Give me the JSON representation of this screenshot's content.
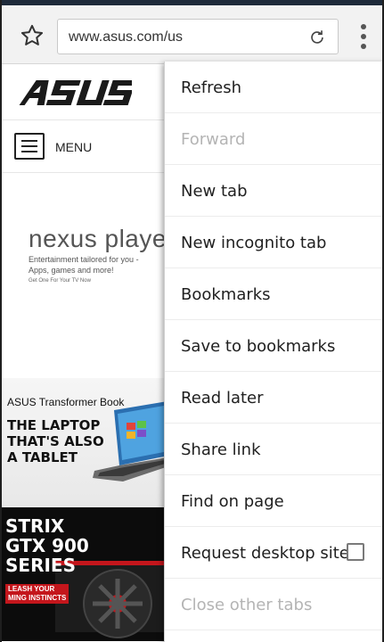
{
  "browser": {
    "url": "www.asus.com/us",
    "icons": {
      "bookmark_star": "star-icon",
      "reload": "reload-icon",
      "overflow": "more-vertical-icon"
    }
  },
  "page": {
    "menu_label": "MENU",
    "nexus": {
      "title": "nexus player",
      "line1": "Entertainment tailored for you -",
      "line2": "Apps, games and more!",
      "cta": "Get One For Your TV Now"
    },
    "transformer": {
      "title": "ASUS Transformer Book",
      "headline_1": "THE LAPTOP",
      "headline_2": "THAT'S ALSO",
      "headline_3": "A TABLET"
    },
    "strix": {
      "headline_1": "STRIX",
      "headline_2": "GTX 900",
      "headline_3": "SERIES",
      "sub_1": "LEASH YOUR",
      "sub_2": "MING INSTINCTS"
    }
  },
  "overflow_menu": {
    "items": [
      {
        "label": "Refresh",
        "enabled": true
      },
      {
        "label": "Forward",
        "enabled": false
      },
      {
        "label": "New tab",
        "enabled": true
      },
      {
        "label": "New incognito tab",
        "enabled": true
      },
      {
        "label": "Bookmarks",
        "enabled": true
      },
      {
        "label": "Save to bookmarks",
        "enabled": true
      },
      {
        "label": "Read later",
        "enabled": true
      },
      {
        "label": "Share link",
        "enabled": true
      },
      {
        "label": "Find on page",
        "enabled": true
      },
      {
        "label": "Request desktop site",
        "enabled": true,
        "checkbox": false
      },
      {
        "label": "Close other tabs",
        "enabled": false
      }
    ]
  },
  "colors": {
    "toolbar": "#f2f2f2",
    "menu_text": "#202020",
    "menu_disabled": "#b4b4b4",
    "strix_red": "#c4161c"
  }
}
